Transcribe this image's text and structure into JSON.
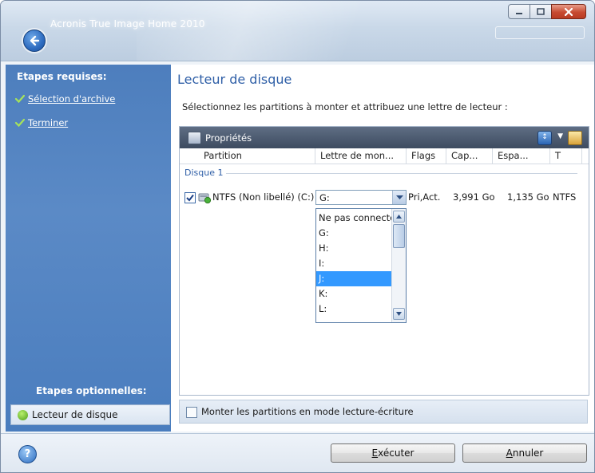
{
  "window": {
    "title": "Acronis True Image Home 2010"
  },
  "sidebar": {
    "required_heading": "Etapes requises:",
    "required_items": [
      {
        "label": "Sélection d'archive",
        "icon": "check-icon"
      },
      {
        "label": "Terminer",
        "icon": "check-icon"
      }
    ],
    "optional_heading": "Etapes optionnelles:",
    "optional_items": [
      {
        "label": "Lecteur de disque",
        "icon": "arrow-right-icon",
        "selected": true
      }
    ]
  },
  "main": {
    "title": "Lecteur de disque",
    "description": "Sélectionnez les partitions à monter et attribuez une lettre de lecteur :",
    "toolbar": {
      "properties_label": "Propriétés"
    },
    "columns": [
      "Partition",
      "Lettre de mon...",
      "Flags",
      "Cap...",
      "Espa...",
      "T"
    ],
    "disk_label": "Disque 1",
    "rows": [
      {
        "checked": true,
        "partition": "NTFS (Non libellé) (C:)",
        "letter": "G:",
        "flags": "Pri,Act.",
        "capacity": "3,991 Go",
        "free": "1,135 Go",
        "type": "NTFS"
      }
    ],
    "dropdown": {
      "options": [
        "Ne pas connecter",
        "G:",
        "H:",
        "I:",
        "J:",
        "K:",
        "L:"
      ],
      "highlighted": "J:"
    },
    "rw_checkbox": {
      "label": "Monter les partitions en mode lecture-écriture",
      "checked": false
    }
  },
  "footer": {
    "execute_label": "Exécuter",
    "execute_mnemonic": "E",
    "execute_rest": "xécuter",
    "cancel_label": "Annuler",
    "cancel_mnemonic": "A",
    "cancel_rest": "nnuler"
  }
}
